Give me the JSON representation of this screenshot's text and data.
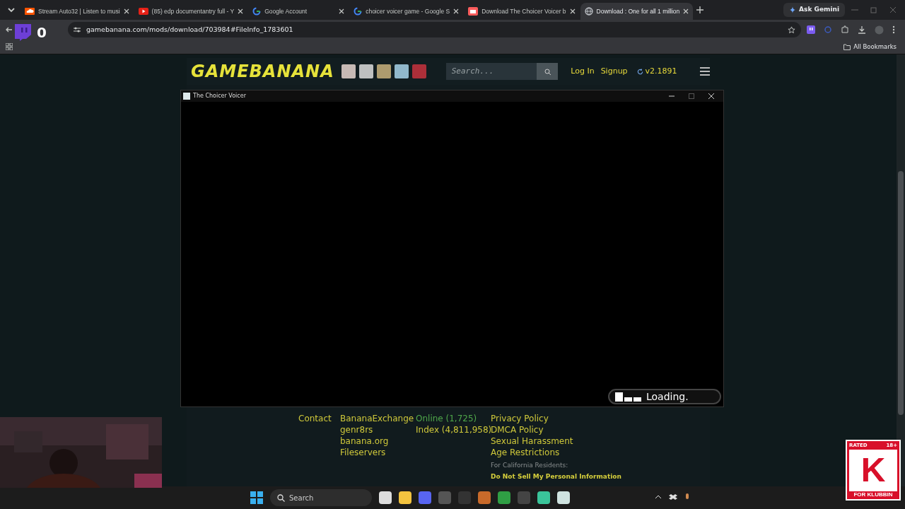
{
  "browser": {
    "tabs": [
      {
        "title": "Stream Auto32 | Listen to musi",
        "kind": "soundcloud",
        "selected": false
      },
      {
        "title": "(85) edp documentantry full - Y",
        "kind": "youtube",
        "selected": false
      },
      {
        "title": "Google Account",
        "kind": "google",
        "selected": false
      },
      {
        "title": "choicer voicer game - Google S",
        "kind": "google",
        "selected": false
      },
      {
        "title": "Download The Choicer Voicer b",
        "kind": "itch",
        "selected": false
      },
      {
        "title": "Download : One for all 1 million",
        "kind": "globe",
        "selected": true
      }
    ],
    "ask_gemini": "Ask Gemini",
    "address": "gamebanana.com/mods/download/703984#FileInfo_1783601",
    "bookmarks_label": "All Bookmarks"
  },
  "stream_overlay": {
    "viewer_count": "0"
  },
  "site": {
    "logo": "GAMEBANANA",
    "search": {
      "placeholder": "Search..."
    },
    "links": [
      "Log In",
      "Signup"
    ],
    "version": "v2.1891"
  },
  "game_window": {
    "title": "The Choicer Voicer",
    "loading": "Loading."
  },
  "footer": {
    "columns": [
      [
        {
          "text": "Contact",
          "kind": "link"
        }
      ],
      [
        {
          "text": "BananaExchange",
          "kind": "link"
        },
        {
          "text": "genr8rs",
          "kind": "link"
        },
        {
          "text": "banana.org",
          "kind": "link"
        },
        {
          "text": "Fileservers",
          "kind": "link"
        }
      ],
      [
        {
          "text": "Online (1,725)",
          "kind": "online"
        },
        {
          "text": "Index (4,811,958)",
          "kind": "link"
        }
      ],
      [
        {
          "text": "Privacy Policy",
          "kind": "link"
        },
        {
          "text": "DMCA Policy",
          "kind": "link"
        },
        {
          "text": "Sexual Harassment",
          "kind": "link"
        },
        {
          "text": "Age Restrictions",
          "kind": "link"
        },
        {
          "text": "For California Residents:",
          "kind": "note"
        },
        {
          "text": "Do Not Sell My Personal Information",
          "kind": "small_link"
        }
      ]
    ]
  },
  "taskbar": {
    "search": {
      "placeholder": "Search"
    }
  },
  "rating_badge": {
    "top_left": "RATED",
    "top_right": "18+",
    "letter": "K",
    "bottom": "FOR KLUBBIN"
  }
}
